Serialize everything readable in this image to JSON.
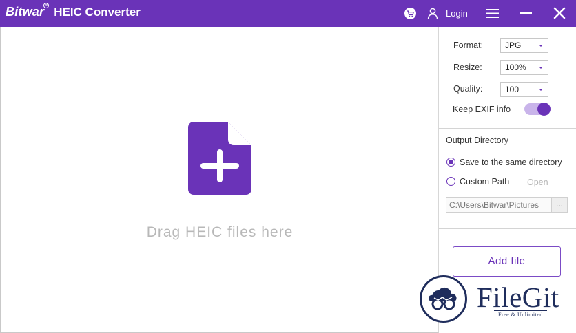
{
  "titlebar": {
    "brand_logo": "Bitwar",
    "brand_reg": "R",
    "app_name": "HEIC Converter",
    "login_label": "Login"
  },
  "dropzone": {
    "label": "Drag HEIC files here"
  },
  "settings": {
    "format_label": "Format:",
    "format_value": "JPG",
    "resize_label": "Resize:",
    "resize_value": "100%",
    "quality_label": "Quality:",
    "quality_value": "100",
    "exif_label": "Keep EXIF info",
    "exif_enabled": true
  },
  "output": {
    "title": "Output Directory",
    "option_same": "Save to the same directory",
    "option_custom": "Custom Path",
    "open_label": "Open",
    "path_value": "C:\\Users\\Bitwar\\Pictures",
    "browse_label": "...",
    "selected": "same"
  },
  "actions": {
    "add_file_label": "Add file"
  },
  "watermark": {
    "name": "FileGit",
    "tagline": "Free & Unlimited"
  },
  "colors": {
    "accent": "#6a33b8",
    "accent_light": "#c9b4ea",
    "watermark_navy": "#1f2d5c"
  }
}
